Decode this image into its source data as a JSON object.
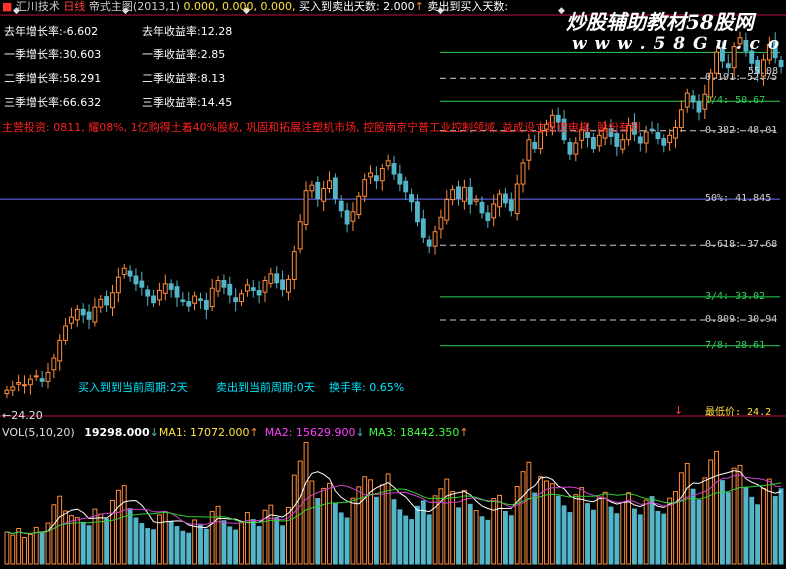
{
  "header": {
    "app_name": "汇川技术",
    "period": "日线",
    "indicator": "帝式主图(2013,1)",
    "values": "0.000, 0.000, 0.000,",
    "buy_to_sell": "买入到卖出天数: 2.000",
    "sell_to_buy": "卖出到买入天数:"
  },
  "watermark": {
    "line1": "炒股辅助教材58股网",
    "line2": "w w w . 5 8 G u . c o m"
  },
  "stats": {
    "left": [
      "去年增长率:-6.602",
      "一季增长率:30.603",
      "二季增长率:58.291",
      "三季增长率:66.632"
    ],
    "right": [
      "去年收益率:12.28",
      "一季收益率:2.85",
      "二季收益率:8.13",
      "三季收益率:14.45"
    ]
  },
  "business_note": "主营投资: 0811, 耀08%, 1亿购得土着40%股权, 巩固和拓展注塑机市场, 控股南京宁普工业控制领域, 益成设立贝德电梯, 股份有利",
  "cycle_info": {
    "buy": "买入到到当前周期:2天",
    "sell": "卖出到当前周期:0天",
    "turnover": "换手率: 0.65%"
  },
  "fib_levels": [
    {
      "label": "0.191: 52.75",
      "price": 52.75,
      "color": "#d0d0d0",
      "dash": true
    },
    {
      "label": "1/4: 50.67",
      "price": 50.67,
      "color": "#2fd35a",
      "dash": false
    },
    {
      "label": "0.382: 48.01",
      "price": 48.01,
      "color": "#d0d0d0",
      "dash": true
    },
    {
      "label": "50%: 41.845",
      "price": 41.845,
      "color": "#7070ff",
      "dash": false
    },
    {
      "label": "0.618: 37.68",
      "price": 37.68,
      "color": "#d0d0d0",
      "dash": true
    },
    {
      "label": "3/4: 33.02",
      "price": 33.02,
      "color": "#2fd35a",
      "dash": false
    },
    {
      "label": "0.809: 30.94",
      "price": 30.94,
      "color": "#d0d0d0",
      "dash": true
    },
    {
      "label": "7/8: 28.61",
      "price": 28.61,
      "color": "#2fd35a",
      "dash": false
    }
  ],
  "top_fib_partial": {
    "label": "55.08",
    "price": 55.08
  },
  "min_price_label": "最低价: 24.2",
  "low_marker": "←24.20",
  "volume_bar": {
    "name": "VOL(5,10,20)",
    "vol": "19298.000",
    "ma1": "MA1: 17072.000",
    "ma2": "MA2: 15629.900",
    "ma3": "MA3: 18442.350"
  },
  "colors": {
    "up": "#ff8c3a",
    "down": "#54b4c8",
    "ma1": "#ffffff",
    "ma2": "#d040d0",
    "ma3": "#30d030",
    "ma1_label": "#ffff60",
    "ma2_label": "#ff40ff",
    "ma3_label": "#40ff40",
    "divider": "#c01040",
    "gold": "#ffe040"
  },
  "chart_data": {
    "type": "candlestick",
    "price_range": [
      23.0,
      58.0
    ],
    "close": [
      24.6,
      24.9,
      25.3,
      25.1,
      25.6,
      25.9,
      25.4,
      26.2,
      27.5,
      29.1,
      30.4,
      31.2,
      31.9,
      31.4,
      31.0,
      32.1,
      32.8,
      32.3,
      33.4,
      34.8,
      35.6,
      34.9,
      34.2,
      33.9,
      33.1,
      32.5,
      33.6,
      34.2,
      33.7,
      33.0,
      32.6,
      32.2,
      33.1,
      32.7,
      31.9,
      33.8,
      34.5,
      33.9,
      33.2,
      32.6,
      33.3,
      34.1,
      33.6,
      33.2,
      34.5,
      35.1,
      34.3,
      33.7,
      34.6,
      37.1,
      39.8,
      42.6,
      43.1,
      41.9,
      42.8,
      43.5,
      41.9,
      40.8,
      39.6,
      40.7,
      42.1,
      43.6,
      44.2,
      43.5,
      44.6,
      45.3,
      44.1,
      43.2,
      42.5,
      41.6,
      39.8,
      38.4,
      37.6,
      38.9,
      40.2,
      41.8,
      42.7,
      41.9,
      42.9,
      41.4,
      41.8,
      40.6,
      39.9,
      41.4,
      42.3,
      41.5,
      40.8,
      43.2,
      45.1,
      47.2,
      46.4,
      47.9,
      48.6,
      49.4,
      48.8,
      47.2,
      45.9,
      46.9,
      48.1,
      47.4,
      46.4,
      47.6,
      48.2,
      47.5,
      46.6,
      47.2,
      48.5,
      47.7,
      46.9,
      47.9,
      48.1,
      47.3,
      46.7,
      47.6,
      48.3,
      49.9,
      51.4,
      50.6,
      49.7,
      51.3,
      53.2,
      55.1,
      54.3,
      53.7,
      55.6,
      56.4,
      55.2,
      54.1,
      53.2,
      54.4,
      55.8,
      54.6,
      53.8
    ],
    "volume": [
      8200,
      7400,
      9100,
      6800,
      7600,
      9400,
      8100,
      10500,
      15200,
      17400,
      13600,
      12400,
      11900,
      10700,
      9800,
      14100,
      12800,
      11600,
      16300,
      18900,
      20100,
      14200,
      11800,
      10400,
      9100,
      8800,
      12600,
      13400,
      10900,
      9600,
      8400,
      7900,
      11300,
      10100,
      8900,
      13500,
      14800,
      11100,
      9500,
      8700,
      10600,
      13200,
      11400,
      9600,
      13800,
      15100,
      11900,
      9800,
      14500,
      22800,
      26400,
      31200,
      21300,
      16800,
      19400,
      20700,
      15600,
      13100,
      11800,
      16900,
      19800,
      22400,
      21600,
      17100,
      20300,
      23100,
      16500,
      13900,
      12300,
      11400,
      14800,
      16200,
      12600,
      17500,
      19300,
      21800,
      18600,
      14400,
      18900,
      15300,
      13700,
      12100,
      11200,
      16800,
      17600,
      13500,
      12400,
      19900,
      23700,
      26100,
      18200,
      22400,
      21300,
      20600,
      17400,
      14900,
      13200,
      17800,
      19600,
      15500,
      13800,
      17200,
      18400,
      14600,
      12900,
      15800,
      18300,
      14100,
      12600,
      16400,
      17300,
      13500,
      12800,
      16900,
      18600,
      23400,
      25800,
      19200,
      16400,
      22100,
      26700,
      28900,
      21400,
      18300,
      24600,
      25300,
      19700,
      17100,
      15200,
      19400,
      21800,
      17300,
      19298
    ]
  }
}
